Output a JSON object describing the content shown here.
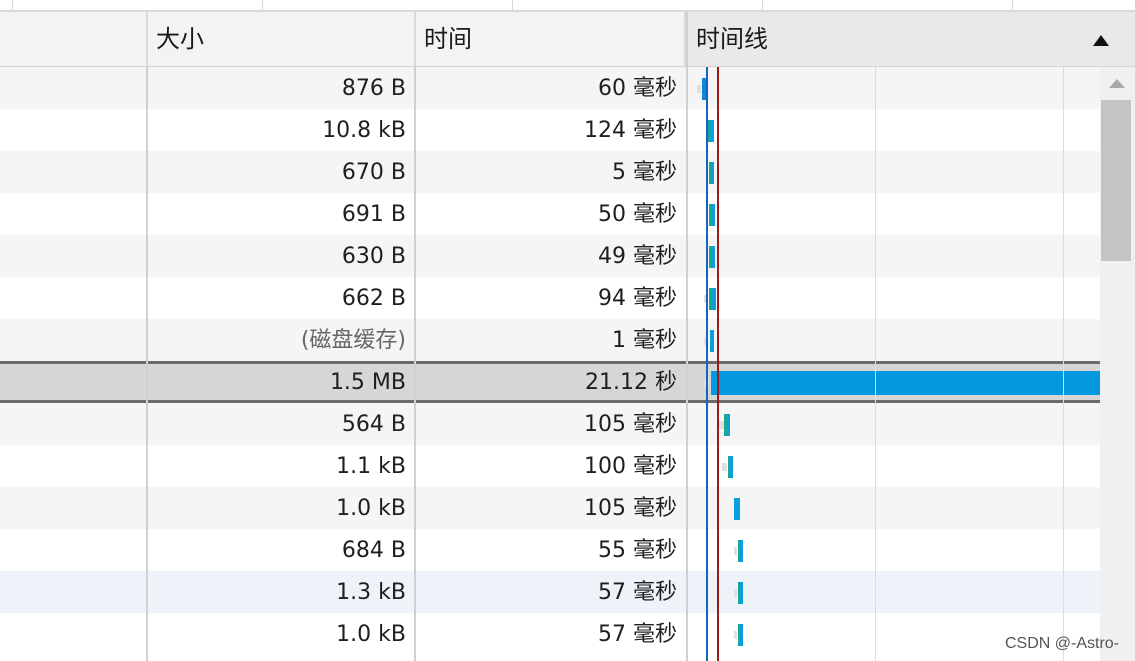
{
  "columns": {
    "size": "大小",
    "time": "时间",
    "timeline": "时间线"
  },
  "rows": [
    {
      "size": "876 B",
      "time": "60  毫秒",
      "bars": [
        {
          "c": "#e0e0e0",
          "s": 0.0,
          "w": 0.01
        },
        {
          "c": "#0b88d6",
          "s": 0.012,
          "w": 0.014
        }
      ]
    },
    {
      "size": "10.8 kB",
      "time": "124  毫秒",
      "bars": [
        {
          "c": "#1aa98e",
          "s": 0.027,
          "w": 0.006
        },
        {
          "c": "#0b9fe0",
          "s": 0.033,
          "w": 0.01
        }
      ]
    },
    {
      "size": "670 B",
      "time": "5  毫秒",
      "bars": [
        {
          "c": "#1aa98e",
          "s": 0.03,
          "w": 0.004
        },
        {
          "c": "#0b9fe0",
          "s": 0.034,
          "w": 0.006
        }
      ]
    },
    {
      "size": "691 B",
      "time": "50  毫秒",
      "bars": [
        {
          "c": "#1aa98e",
          "s": 0.03,
          "w": 0.006
        },
        {
          "c": "#0b9fe0",
          "s": 0.036,
          "w": 0.008
        }
      ]
    },
    {
      "size": "630 B",
      "time": "49  毫秒",
      "bars": [
        {
          "c": "#1aa98e",
          "s": 0.03,
          "w": 0.006
        },
        {
          "c": "#0b9fe0",
          "s": 0.036,
          "w": 0.008
        }
      ]
    },
    {
      "size": "662 B",
      "time": "94  毫秒",
      "bars": [
        {
          "c": "#e0e0e0",
          "s": 0.018,
          "w": 0.01
        },
        {
          "c": "#1aa98e",
          "s": 0.03,
          "w": 0.006
        },
        {
          "c": "#0b9fe0",
          "s": 0.036,
          "w": 0.01
        }
      ]
    },
    {
      "size": "(磁盘缓存)",
      "time": "1  毫秒",
      "muted": true,
      "bars": [
        {
          "c": "#e0e0e0",
          "s": 0.018,
          "w": 0.01
        },
        {
          "c": "#0b9fe0",
          "s": 0.033,
          "w": 0.008
        }
      ]
    },
    {
      "size": "1.5 MB",
      "time": "21.12 秒",
      "selected": true,
      "bars": [
        {
          "c": "#e0e0e0",
          "s": 0.018,
          "w": 0.012
        },
        {
          "c": "#0399df",
          "s": 0.034,
          "w": 0.966
        }
      ]
    },
    {
      "size": "564 B",
      "time": "105  毫秒",
      "bars": [
        {
          "c": "#e0e0e0",
          "s": 0.055,
          "w": 0.012
        },
        {
          "c": "#1aa98e",
          "s": 0.068,
          "w": 0.006
        },
        {
          "c": "#0b9fe0",
          "s": 0.074,
          "w": 0.008
        }
      ]
    },
    {
      "size": "1.1 kB",
      "time": "100  毫秒",
      "bars": [
        {
          "c": "#e0e0e0",
          "s": 0.062,
          "w": 0.012
        },
        {
          "c": "#1aa98e",
          "s": 0.076,
          "w": 0.006
        },
        {
          "c": "#0b9fe0",
          "s": 0.082,
          "w": 0.008
        }
      ]
    },
    {
      "size": "1.0 kB",
      "time": "105  毫秒",
      "bars": [
        {
          "c": "#0b9fe0",
          "s": 0.092,
          "w": 0.014
        }
      ]
    },
    {
      "size": "684 B",
      "time": "55  毫秒",
      "bars": [
        {
          "c": "#e0e0e0",
          "s": 0.092,
          "w": 0.008
        },
        {
          "c": "#1aa98e",
          "s": 0.101,
          "w": 0.006
        },
        {
          "c": "#0b9fe0",
          "s": 0.107,
          "w": 0.008
        }
      ]
    },
    {
      "size": "1.3 kB",
      "time": "57  毫秒",
      "alt": true,
      "bars": [
        {
          "c": "#e0e0e0",
          "s": 0.092,
          "w": 0.008
        },
        {
          "c": "#1aa98e",
          "s": 0.101,
          "w": 0.006
        },
        {
          "c": "#0b9fe0",
          "s": 0.107,
          "w": 0.008
        }
      ]
    },
    {
      "size": "1.0 kB",
      "time": "57  毫秒",
      "bars": [
        {
          "c": "#e0e0e0",
          "s": 0.092,
          "w": 0.008
        },
        {
          "c": "#1aa98e",
          "s": 0.101,
          "w": 0.006
        },
        {
          "c": "#0b9fe0",
          "s": 0.107,
          "w": 0.008
        }
      ]
    }
  ],
  "watermark": "CSDN @-Astro-"
}
